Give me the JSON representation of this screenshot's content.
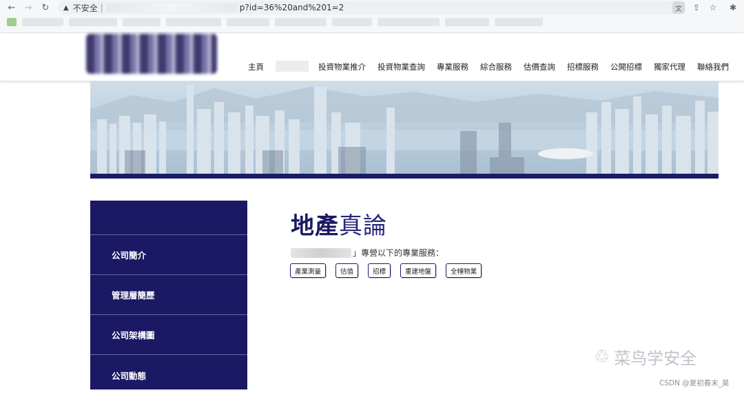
{
  "browser": {
    "back_icon": "arrow-left-icon",
    "forward_icon": "arrow-right-icon",
    "reload_icon": "reload-icon",
    "security_label": "不安全",
    "separator": "|",
    "url_suffix": "p?id=36%20and%201=2",
    "toolbar_icons": [
      "translate-icon",
      "share-icon",
      "star-icon",
      "extensions-icon"
    ]
  },
  "site": {
    "menu": [
      "主頁",
      "投資物業推介",
      "投資物業查詢",
      "專業服務",
      "綜合服務",
      "估價查詢",
      "招標服務",
      "公開招標",
      "獨家代理",
      "聯絡我們"
    ],
    "brand_color": "#1b1964"
  },
  "sidebar": {
    "items": [
      "公司簡介",
      "管理層簡歷",
      "公司架構圖",
      "公司動態"
    ]
  },
  "main": {
    "title_bold": "地產",
    "title_light": "真論",
    "intro_text": "」專營以下的專業服務：",
    "services": [
      "產業測量",
      "估值",
      "招標",
      "重建地盤",
      "全幢物業"
    ]
  },
  "watermark": {
    "wechat_text": "菜鸟学安全",
    "csdn_text": "CSDN @夏初春末_昊"
  }
}
